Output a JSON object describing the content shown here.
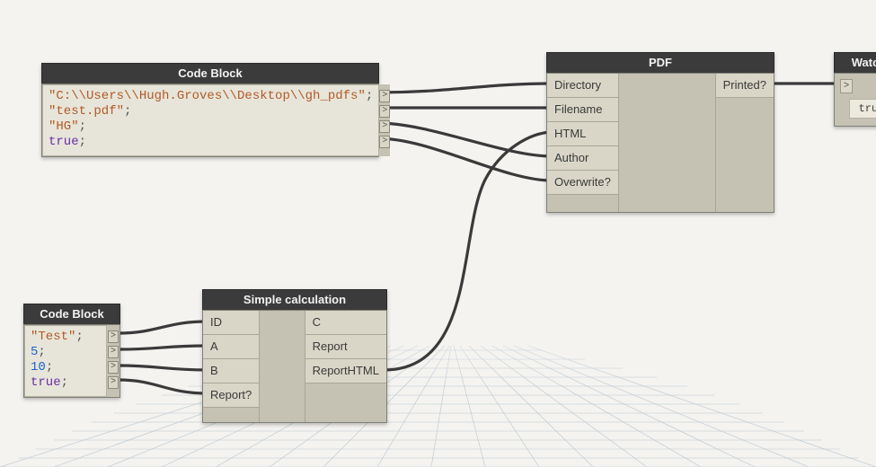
{
  "nodes": {
    "codeblock1": {
      "title": "Code Block",
      "lines": [
        [
          {
            "t": "str",
            "v": "\"C:\\\\Users\\\\Hugh.Groves\\\\Desktop\\\\gh_pdfs\""
          },
          {
            "t": "punc",
            "v": ";"
          }
        ],
        [
          {
            "t": "str",
            "v": "\"test.pdf\""
          },
          {
            "t": "punc",
            "v": ";"
          }
        ],
        [
          {
            "t": "str",
            "v": "\"HG\""
          },
          {
            "t": "punc",
            "v": ";"
          }
        ],
        [
          {
            "t": "bool",
            "v": "true"
          },
          {
            "t": "punc",
            "v": ";"
          }
        ]
      ],
      "out_ports": 4
    },
    "codeblock2": {
      "title": "Code Block",
      "lines": [
        [
          {
            "t": "str",
            "v": "\"Test\""
          },
          {
            "t": "punc",
            "v": ";"
          }
        ],
        [
          {
            "t": "num",
            "v": "5"
          },
          {
            "t": "punc",
            "v": ";"
          }
        ],
        [
          {
            "t": "num",
            "v": "10"
          },
          {
            "t": "punc",
            "v": ";"
          }
        ],
        [
          {
            "t": "bool",
            "v": "true"
          },
          {
            "t": "punc",
            "v": ";"
          }
        ]
      ],
      "out_ports": 4
    },
    "pdf": {
      "title": "PDF",
      "inputs": [
        "Directory",
        "Filename",
        "HTML",
        "Author",
        "Overwrite?"
      ],
      "outputs": [
        "Printed?"
      ]
    },
    "simplecalc": {
      "title": "Simple calculation",
      "inputs": [
        "ID",
        "A",
        "B",
        "Report?"
      ],
      "outputs": [
        "C",
        "Report",
        "ReportHTML"
      ]
    },
    "watch": {
      "title": "Watch",
      "value": "true"
    }
  },
  "port_glyph": ">"
}
